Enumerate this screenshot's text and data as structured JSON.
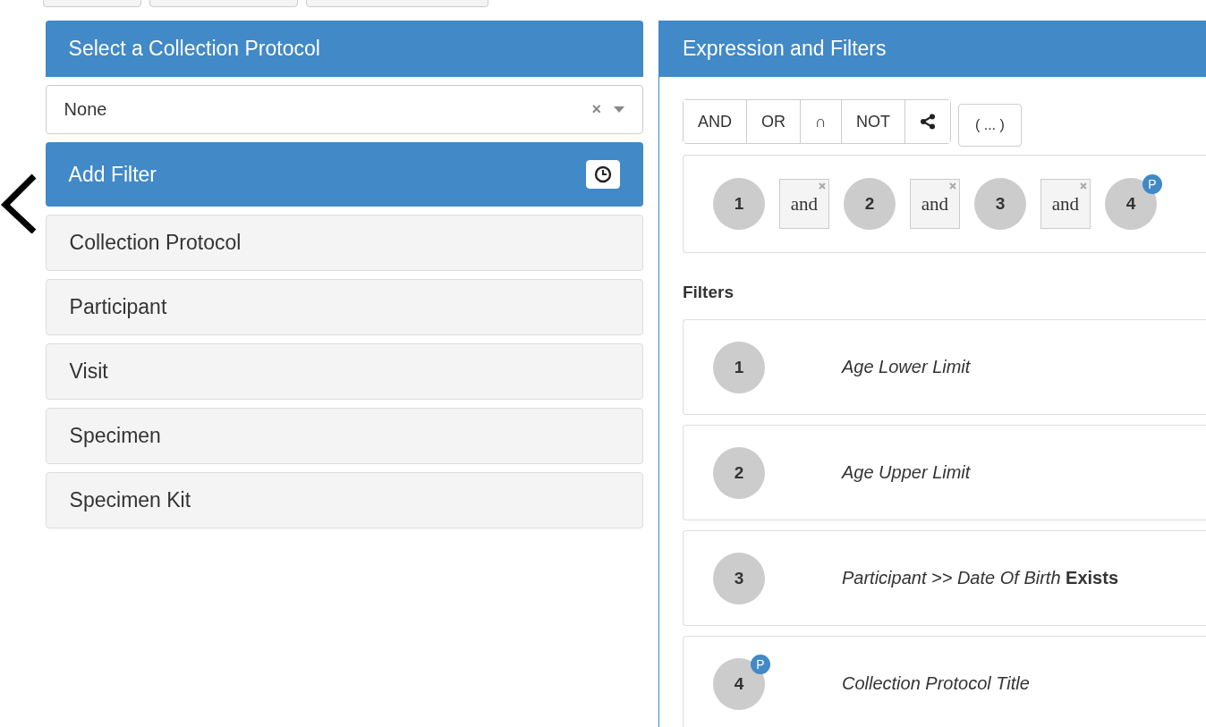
{
  "left": {
    "title": "Select a Collection Protocol",
    "select": {
      "value": "None",
      "clear": "×"
    },
    "add_filter": {
      "title": "Add Filter"
    },
    "items": [
      {
        "label": "Collection Protocol"
      },
      {
        "label": "Participant"
      },
      {
        "label": "Visit"
      },
      {
        "label": "Specimen"
      },
      {
        "label": "Specimen Kit"
      }
    ]
  },
  "right": {
    "title": "Expression and Filters",
    "operators": [
      {
        "label": "AND",
        "kind": "text"
      },
      {
        "label": "OR",
        "kind": "text"
      },
      {
        "label": "∩",
        "kind": "text"
      },
      {
        "label": "NOT",
        "kind": "text"
      },
      {
        "kind": "share"
      }
    ],
    "parens": "( ... )",
    "expression": [
      {
        "kind": "operand",
        "label": "1"
      },
      {
        "kind": "operator",
        "label": "and"
      },
      {
        "kind": "operand",
        "label": "2"
      },
      {
        "kind": "operator",
        "label": "and"
      },
      {
        "kind": "operand",
        "label": "3"
      },
      {
        "kind": "operator",
        "label": "and"
      },
      {
        "kind": "operand",
        "label": "4",
        "badge": "P"
      }
    ],
    "filters_title": "Filters",
    "filters": [
      {
        "number": "1",
        "text": "Age Lower Limit"
      },
      {
        "number": "2",
        "text": "Age Upper Limit"
      },
      {
        "number": "3",
        "text": "Participant >> Date Of Birth **Exists**"
      },
      {
        "number": "4",
        "text": "Collection Protocol Title",
        "badge": "P"
      }
    ]
  }
}
